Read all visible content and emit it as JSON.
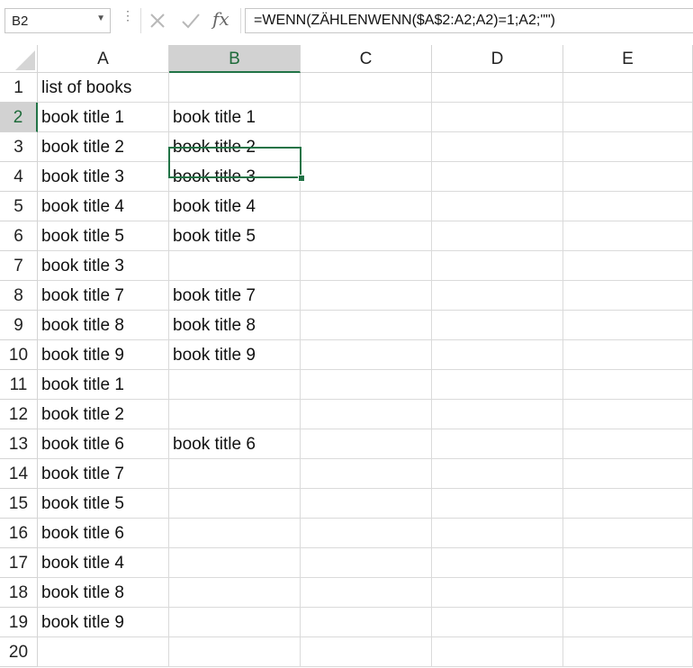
{
  "name_box": {
    "value": "B2"
  },
  "formula_bar": {
    "formula": "=WENN(ZÄHLENWENN($A$2:A2;A2)=1;A2;\"\")",
    "fx_label": "fx"
  },
  "columns": [
    "A",
    "B",
    "C",
    "D",
    "E"
  ],
  "selected_column": "B",
  "selected_row": 2,
  "rows": [
    {
      "n": "1",
      "a": "list of books",
      "b": ""
    },
    {
      "n": "2",
      "a": "book title 1",
      "b": "book title 1"
    },
    {
      "n": "3",
      "a": "book title 2",
      "b": "book title 2"
    },
    {
      "n": "4",
      "a": "book title 3",
      "b": "book title 3"
    },
    {
      "n": "5",
      "a": "book title 4",
      "b": "book title 4"
    },
    {
      "n": "6",
      "a": "book title 5",
      "b": "book title 5"
    },
    {
      "n": "7",
      "a": "book title 3",
      "b": ""
    },
    {
      "n": "8",
      "a": "book title 7",
      "b": "book title 7"
    },
    {
      "n": "9",
      "a": "book title 8",
      "b": "book title 8"
    },
    {
      "n": "10",
      "a": "book title 9",
      "b": "book title 9"
    },
    {
      "n": "11",
      "a": "book title 1",
      "b": ""
    },
    {
      "n": "12",
      "a": "book title 2",
      "b": ""
    },
    {
      "n": "13",
      "a": "book title 6",
      "b": "book title 6"
    },
    {
      "n": "14",
      "a": "book title 7",
      "b": ""
    },
    {
      "n": "15",
      "a": "book title 5",
      "b": ""
    },
    {
      "n": "16",
      "a": "book title 6",
      "b": ""
    },
    {
      "n": "17",
      "a": "book title 4",
      "b": ""
    },
    {
      "n": "18",
      "a": "book title 8",
      "b": ""
    },
    {
      "n": "19",
      "a": "book title 9",
      "b": ""
    },
    {
      "n": "20",
      "a": "",
      "b": ""
    }
  ],
  "colors": {
    "accent": "#217346",
    "header_selected": "#d2d2d2",
    "gridline": "#dadada"
  }
}
